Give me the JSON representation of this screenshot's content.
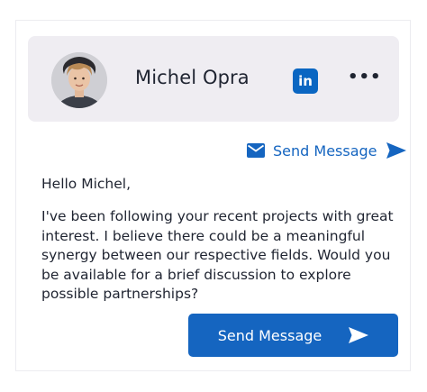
{
  "profile": {
    "name": "Michel Opra",
    "linkedin_icon": "linkedin-icon",
    "linkedin_text": "in",
    "more_icon": "more-horizontal-icon",
    "more_text": "•••"
  },
  "send_link": {
    "icon": "mail-icon",
    "label": "Send Message",
    "arrow_icon": "send-arrow-icon"
  },
  "message": {
    "greeting": "Hello Michel,",
    "body": "I've been following your recent projects with great interest. I believe there could be a meaningful synergy between our respective fields. Would you be available for a brief discussion to explore possible partnerships?"
  },
  "send_button": {
    "label": "Send Message",
    "arrow_icon": "send-arrow-icon"
  },
  "colors": {
    "accent": "#1565c0",
    "linkedin": "#0a66c2",
    "header_bg": "#efedf2",
    "text": "#1f2431"
  }
}
